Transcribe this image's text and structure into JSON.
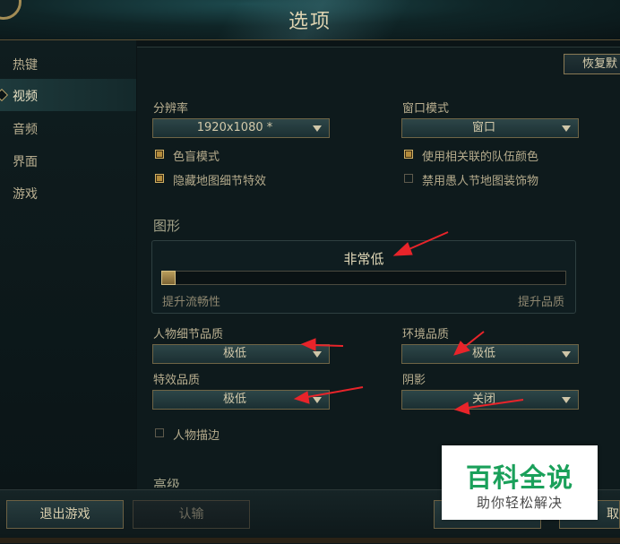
{
  "window": {
    "title": "选项"
  },
  "sidebar": {
    "items": [
      {
        "label": "热键"
      },
      {
        "label": "视频"
      },
      {
        "label": "音频"
      },
      {
        "label": "界面"
      },
      {
        "label": "游戏"
      }
    ],
    "active": "视频"
  },
  "toolbar": {
    "reset_label": "恢复默"
  },
  "video": {
    "resolution_label": "分辨率",
    "resolution_value": "1920x1080 *",
    "window_mode_label": "窗口模式",
    "window_mode_value": "窗口",
    "colorblind_label": "色盲模式",
    "colorblind_checked": true,
    "hide_eyecandy_label": "隐藏地图细节特效",
    "hide_eyecandy_checked": true,
    "team_color_label": "使用相关联的队伍颜色",
    "team_color_checked": true,
    "disable_skin_label": "禁用愚人节地图装饰物",
    "disable_skin_checked": false
  },
  "graphics": {
    "section_label": "图形",
    "preset_value": "非常低",
    "slider_level_fraction": 0.0,
    "hint_left": "提升流畅性",
    "hint_right": "提升品质",
    "character_quality_label": "人物细节品质",
    "character_quality_value": "极低",
    "environment_quality_label": "环境品质",
    "environment_quality_value": "极低",
    "effects_quality_label": "特效品质",
    "effects_quality_value": "极低",
    "shadows_label": "阴影",
    "shadows_value": "关闭",
    "outline_label": "人物描边",
    "outline_checked": false
  },
  "advanced": {
    "section_label": "高级"
  },
  "footer": {
    "exit_label": "退出游戏",
    "surrender_label": "认输",
    "cancel_label": "取"
  },
  "watermark": {
    "title": "百科全说",
    "subtitle": "助你轻松解决"
  },
  "colors": {
    "accent_gold": "#b38b3b",
    "panel_bg": "#0e1a1c",
    "annotation_red": "#e8242a",
    "watermark_green": "#1aa05a"
  }
}
